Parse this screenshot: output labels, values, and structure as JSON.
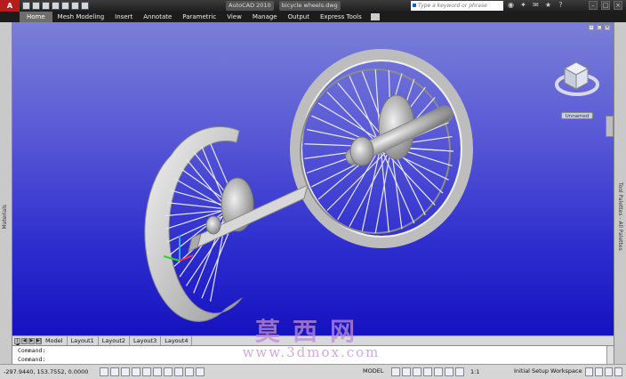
{
  "app": {
    "logo": "A",
    "title_parts": [
      "AutoCAD 2010",
      "bicycle wheels.dwg"
    ],
    "search_placeholder": "Type a keyword or phrase"
  },
  "ribbon": {
    "tabs": [
      "Home",
      "Mesh Modeling",
      "Insert",
      "Annotate",
      "Parametric",
      "View",
      "Manage",
      "Output",
      "Express Tools"
    ]
  },
  "palettes": {
    "left": "Materials",
    "right": "Tool Palettes - All Palettes"
  },
  "viewport": {
    "view_label": "Unnamed",
    "background_top": "#7a7fd6",
    "background_bottom": "#1512c0"
  },
  "layouts": {
    "tabs": [
      "Model",
      "Layout1",
      "Layout2",
      "Layout3",
      "Layout4"
    ]
  },
  "command": {
    "lines": [
      "Command:",
      "Command:"
    ]
  },
  "status": {
    "coords": "-297.9440, 153.7552, 0.0000",
    "model": "MODEL",
    "scale": "1:1",
    "workspace": "Initial Setup Workspace"
  },
  "watermark": {
    "chinese": "莫西网",
    "url": "www.3dmox.com"
  }
}
